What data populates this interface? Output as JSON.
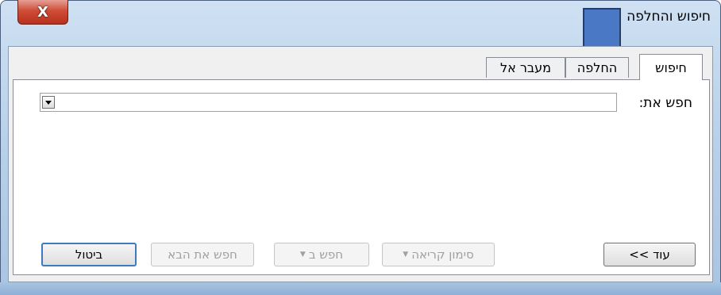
{
  "window": {
    "title": "חיפוש והחלפה",
    "close_label": "X",
    "colors": {
      "frame": "#b9d1ea",
      "close_button": "#cf4c36",
      "overlay": "#4a78c4"
    }
  },
  "tabs": [
    {
      "label": "חיפוש",
      "active": true
    },
    {
      "label": "החלפה",
      "active": false
    },
    {
      "label": "מעבר אל",
      "active": false
    }
  ],
  "find": {
    "label": "חפש את:",
    "value": "",
    "dropdown_icon": "chevron-down-icon"
  },
  "buttons": {
    "more": "עוד >>",
    "reading_highlight": "סימון קריאה",
    "find_in": "חפש ב",
    "find_next": "חפש את הבא",
    "cancel": "ביטול"
  }
}
